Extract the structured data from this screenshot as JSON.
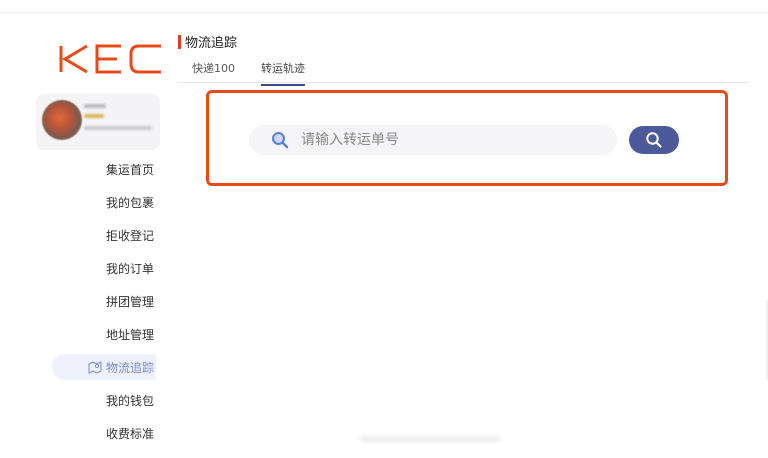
{
  "brand": {
    "logo_text": "KEC",
    "logo_color": "#e64a19"
  },
  "sidebar": {
    "items": [
      {
        "label": "集运首页"
      },
      {
        "label": "我的包裹"
      },
      {
        "label": "拒收登记"
      },
      {
        "label": "我的订单"
      },
      {
        "label": "拼团管理"
      },
      {
        "label": "地址管理"
      },
      {
        "label": "物流追踪",
        "active": true,
        "icon": "map-icon"
      },
      {
        "label": "我的钱包"
      },
      {
        "label": "收费标准"
      }
    ]
  },
  "main": {
    "title": "物流追踪",
    "tabs": [
      {
        "label": "快递100"
      },
      {
        "label": "转运轨迹",
        "active": true
      }
    ],
    "search": {
      "placeholder": "请输入转运单号",
      "value": "",
      "button_icon": "search-icon"
    }
  },
  "colors": {
    "accent": "#4c5a9c",
    "highlight_frame": "#e64a19",
    "title_bar": "#e03a2b",
    "active_nav_bg": "#eef1fb",
    "active_nav_text": "#7a8bd0"
  }
}
